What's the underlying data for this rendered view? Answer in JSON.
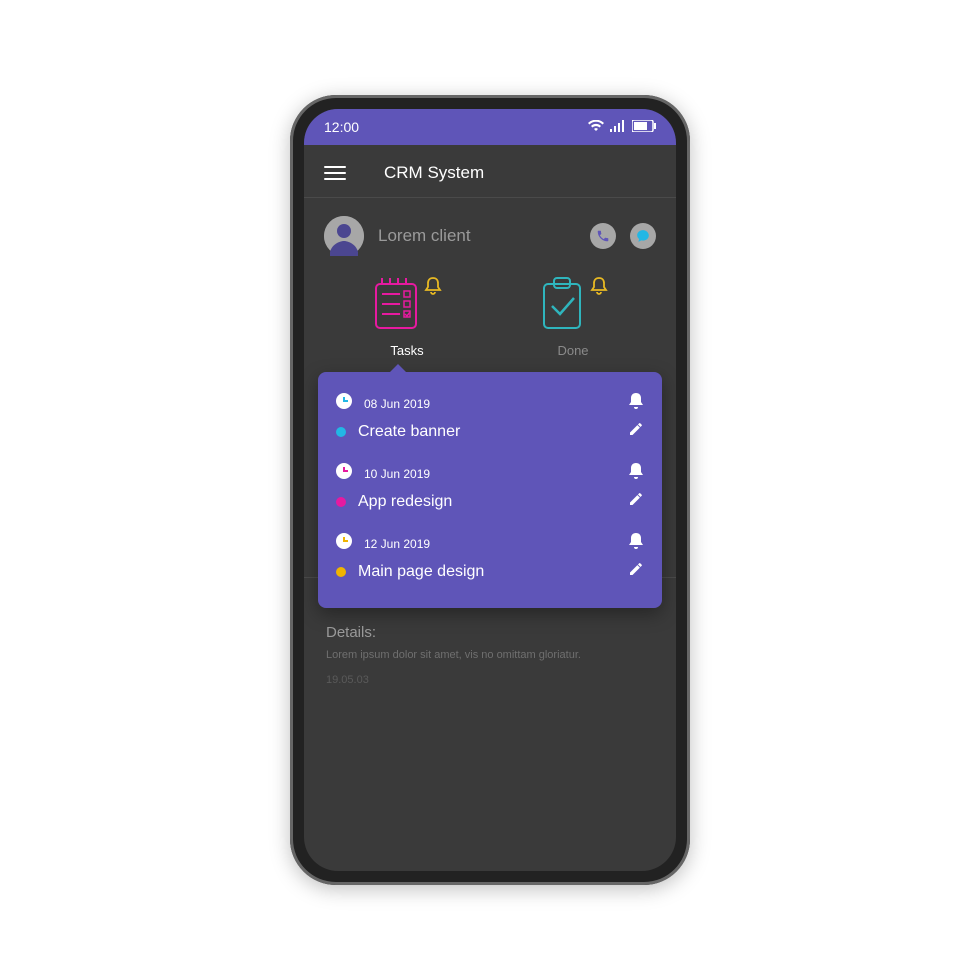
{
  "status": {
    "time": "12:00"
  },
  "header": {
    "title": "CRM System"
  },
  "client": {
    "name": "Lorem client"
  },
  "tabs": {
    "tasks": "Tasks",
    "done": "Done"
  },
  "tasks": [
    {
      "date": "08 Jun 2019",
      "title": "Create banner",
      "dot": "#22b7e5",
      "clockAccent": "#22b7e5"
    },
    {
      "date": "10 Jun 2019",
      "title": "App redesign",
      "dot": "#e61aa0",
      "clockAccent": "#e61aa0"
    },
    {
      "date": "12 Jun 2019",
      "title": "Main page design",
      "dot": "#f0b400",
      "clockAccent": "#f0b400"
    }
  ],
  "details": {
    "label": "Details:",
    "body": "Lorem ipsum dolor sit amet, vis no omittam gloriatur.",
    "date": "19.05.03"
  },
  "colors": {
    "accent": "#5f55b8",
    "pink": "#e61aa0",
    "teal": "#2fb5bd",
    "gold": "#e8b923"
  }
}
